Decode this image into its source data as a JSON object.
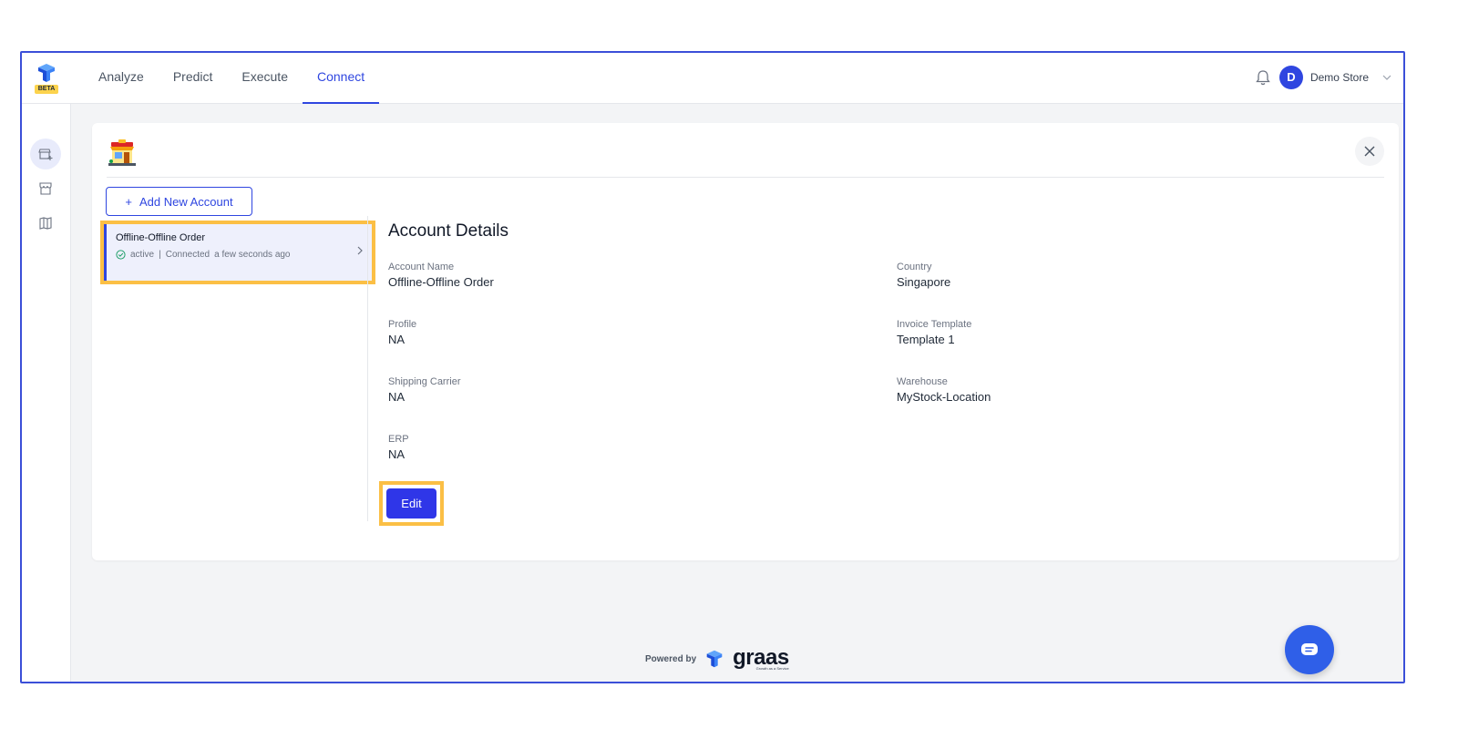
{
  "logo": {
    "badge": "BETA"
  },
  "nav": {
    "tabs": [
      {
        "label": "Analyze"
      },
      {
        "label": "Predict"
      },
      {
        "label": "Execute"
      },
      {
        "label": "Connect",
        "active": true
      }
    ]
  },
  "header": {
    "avatar_initial": "D",
    "store_name": "Demo Store"
  },
  "sidebar": {
    "items": [
      {
        "icon": "store-add-icon",
        "active": true
      },
      {
        "icon": "storefront-icon"
      },
      {
        "icon": "map-icon"
      }
    ]
  },
  "card": {
    "add_account_label": "Add New Account",
    "add_icon": "+",
    "account": {
      "name": "Offline-Offline Order",
      "status": "active",
      "separator": "|",
      "connection": "Connected",
      "time": "a few seconds ago"
    },
    "details": {
      "title": "Account Details",
      "fields": [
        {
          "label": "Account Name",
          "value": "Offline-Offline Order"
        },
        {
          "label": "Country",
          "value": "Singapore"
        },
        {
          "label": "Profile",
          "value": "NA"
        },
        {
          "label": "Invoice Template",
          "value": "Template 1"
        },
        {
          "label": "Shipping Carrier",
          "value": "NA"
        },
        {
          "label": "Warehouse",
          "value": "MyStock-Location"
        },
        {
          "label": "ERP",
          "value": "NA"
        }
      ],
      "edit_label": "Edit"
    }
  },
  "footer": {
    "powered_by": "Powered by",
    "brand": "graas",
    "tagline": "Growth as a Service"
  },
  "colors": {
    "accent": "#2f46e0",
    "highlight": "#fbbf45",
    "selected_bg": "#eef0fc",
    "status_green": "#22a06b"
  }
}
